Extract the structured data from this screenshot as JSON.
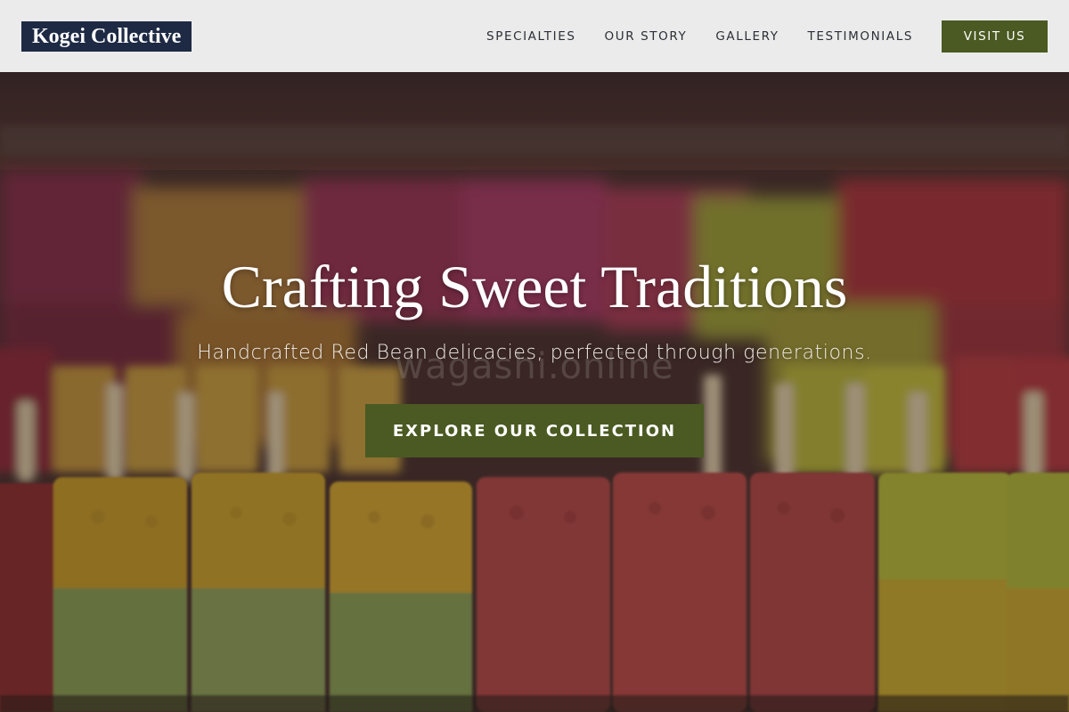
{
  "navbar": {
    "logo_text": "Kogei Collective",
    "links": [
      "SPECIALTIES",
      "OUR STORY",
      "GALLERY",
      "TESTIMONIALS"
    ],
    "cta_label": "VISIT US"
  },
  "hero": {
    "title": "Crafting Sweet Traditions",
    "subtitle": "Handcrafted Red Bean delicacies, perfected through generations.",
    "watermark": "wagashi.online",
    "cta_label": "EXPLORE OUR COLLECTION"
  },
  "colors": {
    "logo_bg": "#1e2a44",
    "accent_green": "#4a5a22",
    "nav_bg": "#ebebeb",
    "nav_text": "#2b2f36"
  }
}
